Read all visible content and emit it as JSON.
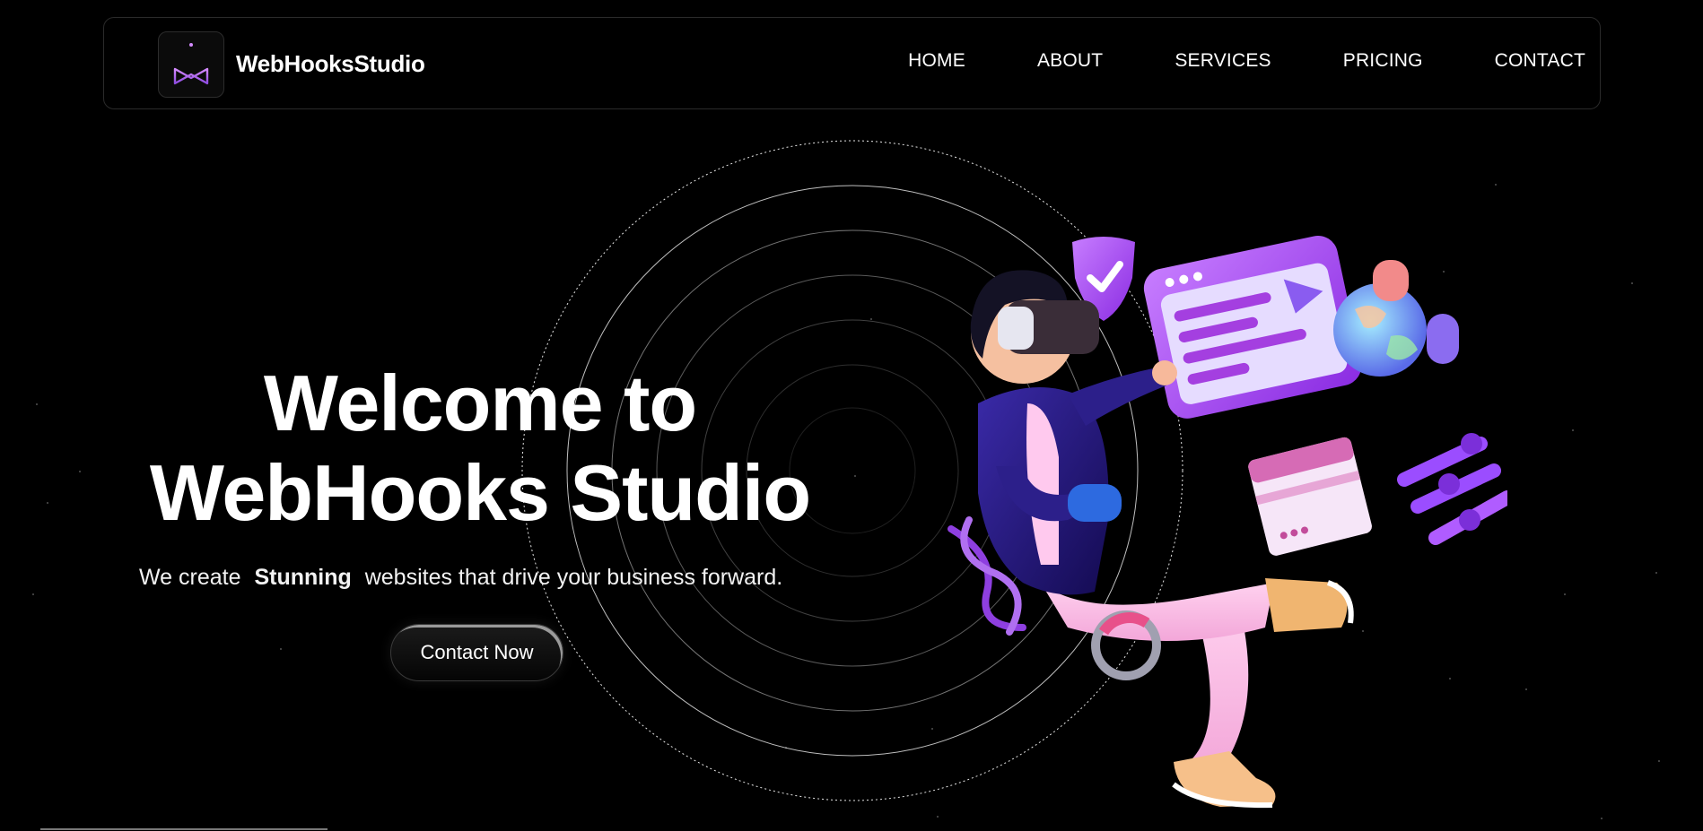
{
  "brand": {
    "name": "WebHooksStudio",
    "logo_icon": "castle-logo-icon"
  },
  "nav": {
    "items": [
      {
        "label": "HOME"
      },
      {
        "label": "ABOUT"
      },
      {
        "label": "SERVICES"
      },
      {
        "label": "PRICING"
      },
      {
        "label": "CONTACT"
      }
    ]
  },
  "hero": {
    "title_line1": "Welcome to",
    "title_line2": "WebHooks Studio",
    "subtitle_before": "We create",
    "subtitle_strong": "Stunning",
    "subtitle_after": "websites that drive your business forward.",
    "cta_label": "Contact Now"
  },
  "colors": {
    "background": "#000000",
    "accent_purple": "#a84ee0",
    "accent_pink": "#e05ab8",
    "text": "#ffffff"
  }
}
